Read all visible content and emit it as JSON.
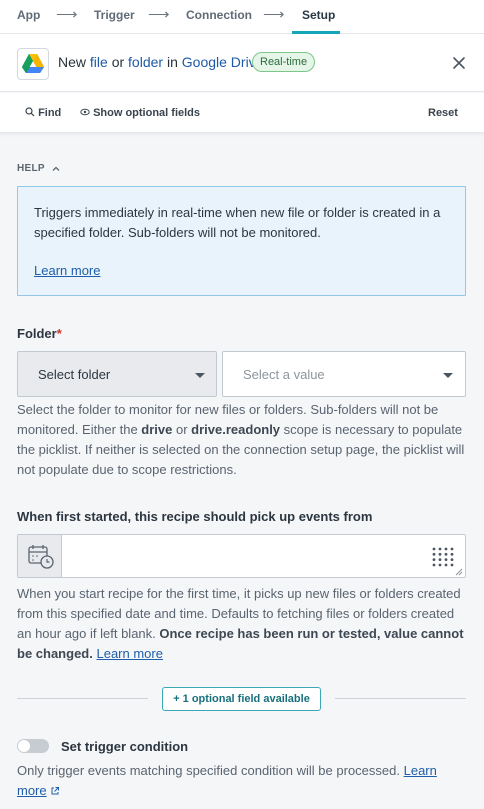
{
  "steps": [
    {
      "label": "App"
    },
    {
      "label": "Trigger"
    },
    {
      "label": "Connection"
    },
    {
      "label": "Setup",
      "active": true
    }
  ],
  "step_arrow": "⟶",
  "header": {
    "title_new": "New",
    "title_file": "file",
    "title_or": "or",
    "title_folder": "folder",
    "title_in": "in",
    "title_app": "Google Drive",
    "badge": "Real-time",
    "app_icon": "google-drive-icon",
    "close_icon": "close-icon"
  },
  "toolbar": {
    "find_label": "Find",
    "optional_label": "Show optional fields",
    "reset_label": "Reset"
  },
  "help": {
    "label": "HELP",
    "text": "Triggers immediately in real-time when new file or folder is created in a specified folder. Sub-folders will not be monitored.",
    "link": "Learn more"
  },
  "folder": {
    "label": "Folder",
    "required_mark": "*",
    "type_select": "Select folder",
    "value_placeholder": "Select a value",
    "hint_part1": "Select the folder to monitor for new files or folders. Sub-folders will not be monitored. Either the ",
    "hint_drive": "drive",
    "hint_or": " or ",
    "hint_readonly": "drive.readonly",
    "hint_part2": " scope is necessary to populate the picklist. If neither is selected on the connection setup page, the picklist will not populate due to scope restrictions."
  },
  "since": {
    "label": "When first started, this recipe should pick up events from",
    "value": "",
    "hint_part1": "When you start recipe for the first time, it picks up new files or folders created from this specified date and time. Defaults to fetching files or folders created an hour ago if left blank. ",
    "hint_bold": "Once recipe has been run or tested, value cannot be changed.",
    "hint_link": "Learn more"
  },
  "optional": {
    "button": "+ 1 optional field available"
  },
  "trigger_condition": {
    "label": "Set trigger condition",
    "enabled": false,
    "hint": "Only trigger events matching specified condition will be processed.",
    "link": "Learn more"
  },
  "colors": {
    "accent": "#14a6b8",
    "link": "#1f5ea9",
    "help_bg": "#e8f3fc",
    "badge_bg": "#e5f5e8",
    "required": "#d0342c"
  }
}
